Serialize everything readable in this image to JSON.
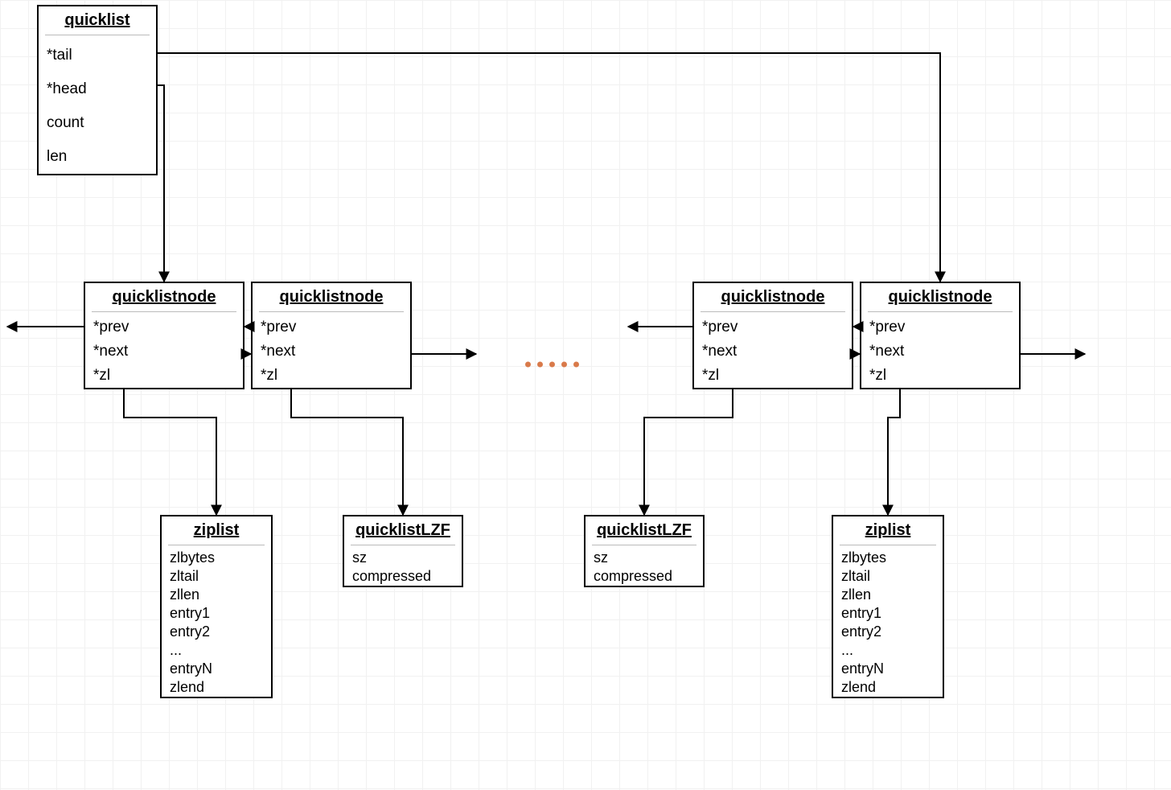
{
  "quicklist": {
    "title": "quicklist",
    "fields": [
      "*tail",
      "*head",
      "count",
      "len"
    ]
  },
  "node": {
    "title": "quicklistnode",
    "fields": [
      "*prev",
      "*next",
      "*zl"
    ]
  },
  "ziplist": {
    "title": "ziplist",
    "fields": [
      "zlbytes",
      "zltail",
      "zllen",
      "entry1",
      "entry2",
      "...",
      "entryN",
      "zlend"
    ]
  },
  "lzf": {
    "title": "quicklistLZF",
    "fields": [
      "sz",
      "compressed"
    ]
  },
  "ellipsis_dots": 5
}
